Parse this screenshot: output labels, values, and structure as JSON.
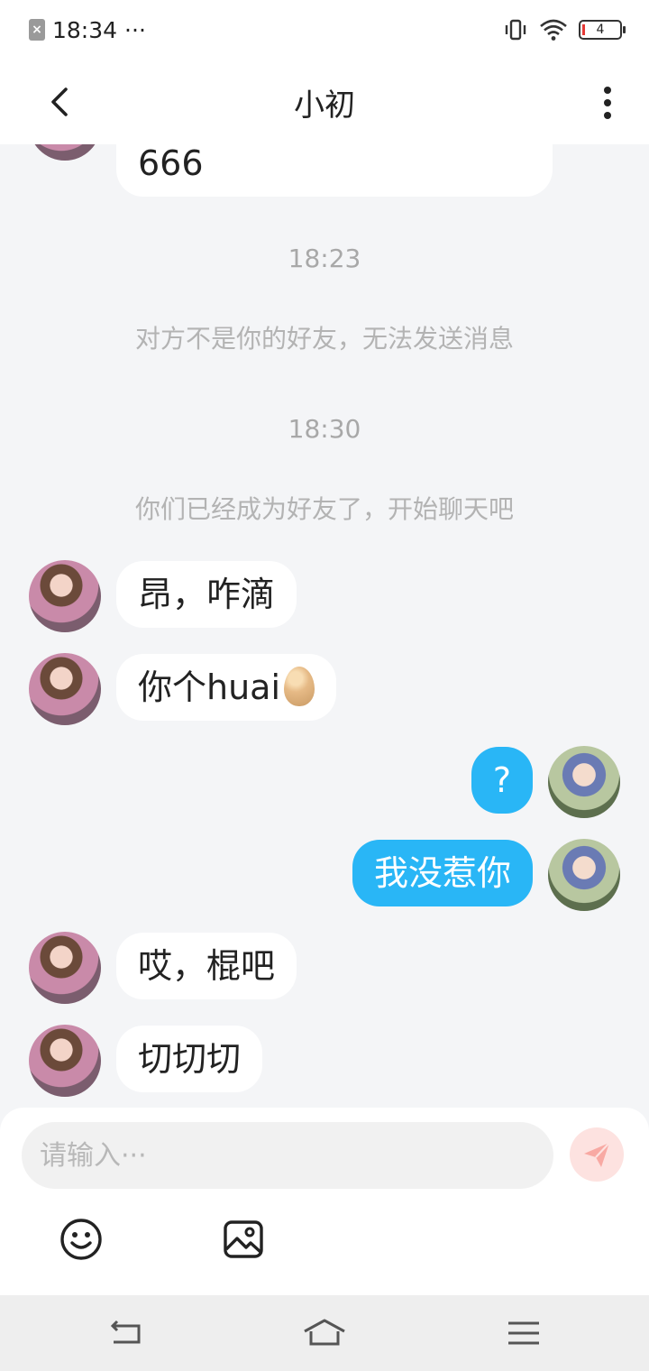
{
  "status_bar": {
    "time": "18:34",
    "dots": "···",
    "battery_level": "4"
  },
  "header": {
    "title": "小初"
  },
  "chat": {
    "partial_message": "666",
    "timestamp_1": "18:23",
    "system_1": "对方不是你的好友，无法发送消息",
    "timestamp_2": "18:30",
    "system_2": "你们已经成为好友了，开始聊天吧",
    "messages": [
      {
        "text": "昂，咋滴"
      },
      {
        "text": "你个huai"
      },
      {
        "text": "?"
      },
      {
        "text": "我没惹你"
      },
      {
        "text": "哎，棍吧"
      },
      {
        "text": "切切切"
      }
    ]
  },
  "input": {
    "placeholder": "请输入···"
  },
  "colors": {
    "outgoing_bubble": "#29b6f6",
    "send_button_bg": "#fde2e0",
    "send_icon": "#f8a9a3"
  },
  "icons": {
    "back": "chevron-left-icon",
    "more": "more-vertical-icon",
    "send": "paper-plane-icon",
    "emoji": "smiley-icon",
    "image": "image-icon"
  }
}
